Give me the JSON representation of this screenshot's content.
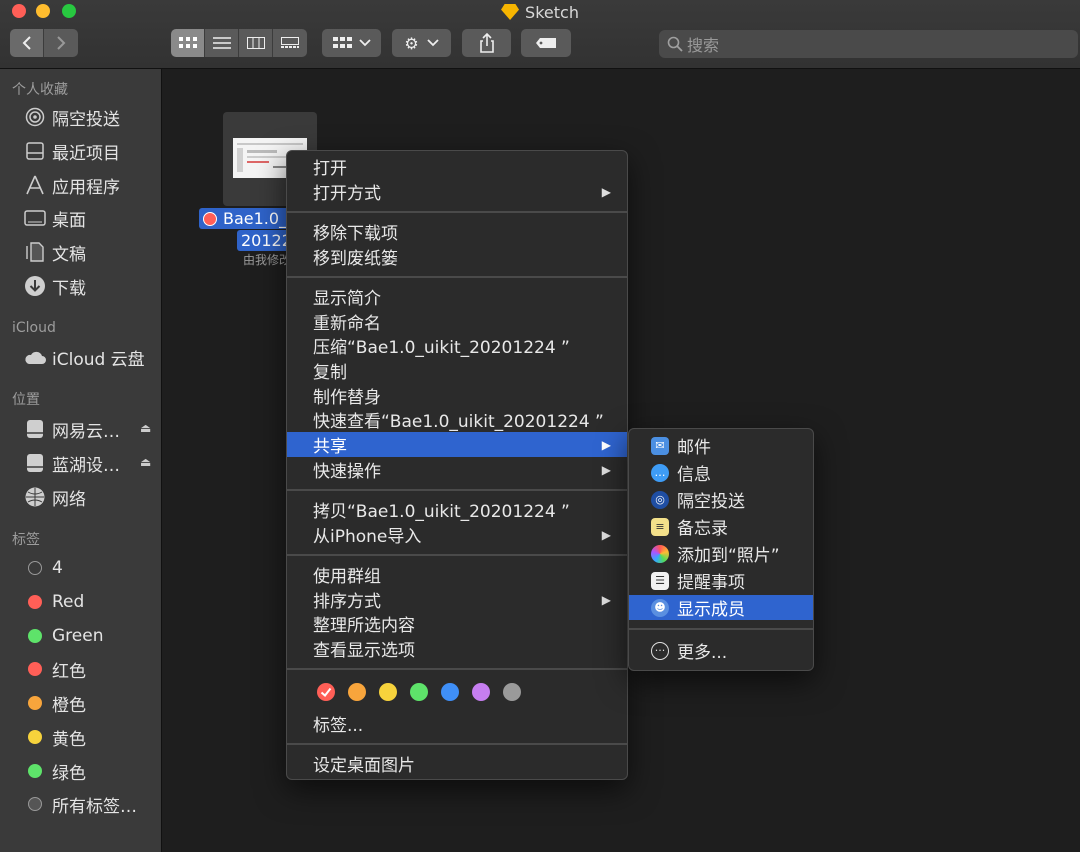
{
  "window": {
    "title": "Sketch"
  },
  "toolbar": {
    "search_placeholder": "搜索"
  },
  "sidebar": {
    "favorites_header": "个人收藏",
    "favorites": [
      {
        "label": "隔空投送",
        "icon": "airdrop-icon"
      },
      {
        "label": "最近项目",
        "icon": "recents-icon"
      },
      {
        "label": "应用程序",
        "icon": "applications-icon"
      },
      {
        "label": "桌面",
        "icon": "desktop-icon"
      },
      {
        "label": "文稿",
        "icon": "documents-icon"
      },
      {
        "label": "下载",
        "icon": "downloads-icon"
      }
    ],
    "icloud_header": "iCloud",
    "icloud": [
      {
        "label": "iCloud 云盘",
        "icon": "cloud-icon"
      }
    ],
    "locations_header": "位置",
    "locations": [
      {
        "label": "网易云…",
        "icon": "disk-icon"
      },
      {
        "label": "蓝湖设…",
        "icon": "disk-icon"
      },
      {
        "label": "网络",
        "icon": "network-icon"
      }
    ],
    "tags_header": "标签",
    "tags": [
      {
        "label": "4",
        "color": "#3a3a3a"
      },
      {
        "label": "Red",
        "color": "#ff5f57"
      },
      {
        "label": "Green",
        "color": "#5ee36a"
      },
      {
        "label": "红色",
        "color": "#ff5f57"
      },
      {
        "label": "橙色",
        "color": "#f8a53c"
      },
      {
        "label": "黄色",
        "color": "#f7d33c"
      },
      {
        "label": "绿色",
        "color": "#5ee36a"
      },
      {
        "label": "所有标签…",
        "color": "#777777"
      }
    ]
  },
  "file": {
    "name_line1": "Bae1.0_u",
    "name_line2": "20122",
    "meta": "由我修改"
  },
  "context_menu": {
    "open": "打开",
    "open_with": "打开方式",
    "remove_download": "移除下载项",
    "move_to_trash": "移到废纸篓",
    "get_info": "显示简介",
    "rename": "重新命名",
    "compress": "压缩“Bae1.0_uikit_20201224 ”",
    "duplicate": "复制",
    "make_alias": "制作替身",
    "quick_look": "快速查看“Bae1.0_uikit_20201224 ”",
    "share": "共享",
    "quick_actions": "快速操作",
    "copy": "拷贝“Bae1.0_uikit_20201224 ”",
    "import_iphone": "从iPhone导入",
    "use_groups": "使用群组",
    "sort_by": "排序方式",
    "clean_up": "整理所选内容",
    "view_options": "查看显示选项",
    "tag_colors": [
      "#ff5f57",
      "#f8a53c",
      "#f7d33c",
      "#5ee36a",
      "#3f8ff7",
      "#c67ef0",
      "#9a9a9a"
    ],
    "tags": "标签...",
    "set_desktop": "设定桌面图片"
  },
  "share_menu": {
    "mail": "邮件",
    "messages": "信息",
    "airdrop": "隔空投送",
    "notes": "备忘录",
    "add_to_photos": "添加到“照片”",
    "reminders": "提醒事项",
    "show_members": "显示成员",
    "more": "更多..."
  }
}
